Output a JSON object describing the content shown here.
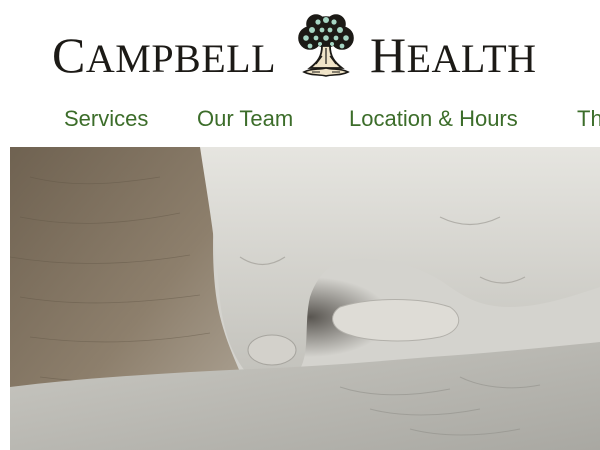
{
  "logo": {
    "left_initial": "C",
    "left_rest": "AMPBELL",
    "right_initial": "H",
    "right_rest": "EALTH",
    "tree_icon": "tree-logo-icon",
    "colors": {
      "text": "#1c1a16",
      "leaves": "#a6d6c4",
      "trunk": "#f0e4c8",
      "outline": "#1c1a16"
    }
  },
  "nav": {
    "items": [
      {
        "label": "Services"
      },
      {
        "label": "Our Team"
      },
      {
        "label": "Location & Hours"
      },
      {
        "label": "Th"
      }
    ],
    "color": "#3c6d2a"
  },
  "hero": {
    "image_icon": "holding-hands-photo"
  }
}
